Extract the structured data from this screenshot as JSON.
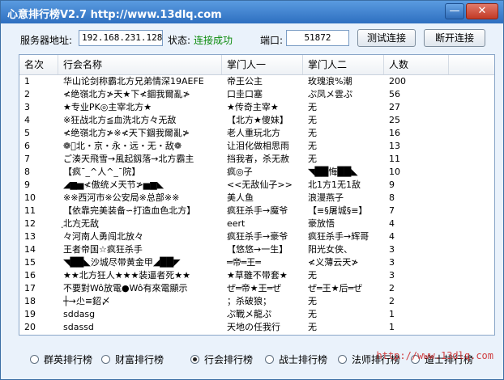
{
  "window": {
    "title": "心意排行榜V2.7 http://www.13dlq.com",
    "minimize_symbol": "—",
    "close_symbol": "✕"
  },
  "connection": {
    "server_label": "服务器地址:",
    "server_value": "192.168.231.128",
    "status_label": "状态:",
    "status_value": "连接成功",
    "port_label": "端口:",
    "port_value": "51872",
    "test_button": "测试连接",
    "disconnect_button": "断开连接"
  },
  "table": {
    "headers": [
      "名次",
      "行会名称",
      "掌门人一",
      "掌门人二",
      "人数"
    ],
    "rows": [
      [
        "1",
        "华山论剑称霸北方兄弟情深19AEFE",
        "帝王公主",
        "玫瑰浪%潮",
        "200"
      ],
      [
        "2",
        "≮绝嶺北方≯天★下≮錮我爾亂≯",
        "口圭口塞",
        "ぷ凤メ雲ぷ",
        "56"
      ],
      [
        "3",
        "★专业PK◎主宰北方★",
        "★传奇主宰★",
        "无",
        "27"
      ],
      [
        "4",
        "※狂战北方≦血洗北方々无敌",
        "【北方★傻妹】",
        "无",
        "25"
      ],
      [
        "5",
        "≮绝嶺北方≯※≮天下錮我爾亂≯",
        "老人重玩北方",
        "无",
        "16"
      ],
      [
        "6",
        "❁ฺ北・京・永・远・无・敌ฺ❁",
        "让泪化做相思雨",
        "无",
        "13"
      ],
      [
        "7",
        "ご湊天飛雪→風起釼落→北方霸主",
        "挡我者，杀无赦",
        "无",
        "11"
      ],
      [
        "8",
        "【疯¯_^人^_¯院】",
        "疯◎子",
        "◥██悔██◣",
        "10"
      ],
      [
        "9",
        "◢▆▅≮傲统メ天节≯▅▆◣",
        "<<无敌仙子>>",
        "北1方1无1敌",
        "9"
      ],
      [
        "10",
        "※※西河市※公安局※总部※※",
        "美人鱼",
        "浪漫燕子",
        "8"
      ],
      [
        "11",
        "【依靠完美装备∽打造血色北方】",
        "疯狂杀手→魔爷",
        "【≡§屠城§≡】",
        "7"
      ],
      [
        "12",
        "ฺ北方ฺ无敌ฺ",
        "eert",
        "豪放悟",
        "4"
      ],
      [
        "13",
        "々河南人勇闯北放々",
        "疯狂杀手→豪爷",
        "疯狂杀手→辉哥",
        "4"
      ],
      [
        "14",
        "王者帝国☆疯狂杀手",
        "【悠悠→一生】",
        "阳光女侠、",
        "3"
      ],
      [
        "15",
        "◥██◣沙城尽带黄金甲◢██◤",
        "═帝═王═",
        "≮义薄云天≯",
        "3"
      ],
      [
        "16",
        "★★北方狂人★★★装逼者死★★",
        "★草雖不带套★",
        "无",
        "3"
      ],
      [
        "17",
        "不要對Wô放電●Wô有來電顯示",
        "ぜ═帝★王═ぜ",
        "ぜ═王★后═ぜ",
        "2"
      ],
      [
        "18",
        "┼→尐≡鉊〆",
        "；杀破狼；",
        "无",
        "2"
      ],
      [
        "19",
        "sddasg",
        "ぷ戰メ龍ぷ",
        "无",
        "1"
      ],
      [
        "20",
        "sdassd",
        "天地の任我行",
        "无",
        "1"
      ]
    ]
  },
  "rankings": {
    "options": [
      "群英排行榜",
      "财富排行榜",
      "行会排行榜",
      "战士排行榜",
      "法师排行榜",
      "道士排行榜"
    ],
    "selected": "行会排行榜"
  },
  "watermark": "http://www.13dlq.com"
}
